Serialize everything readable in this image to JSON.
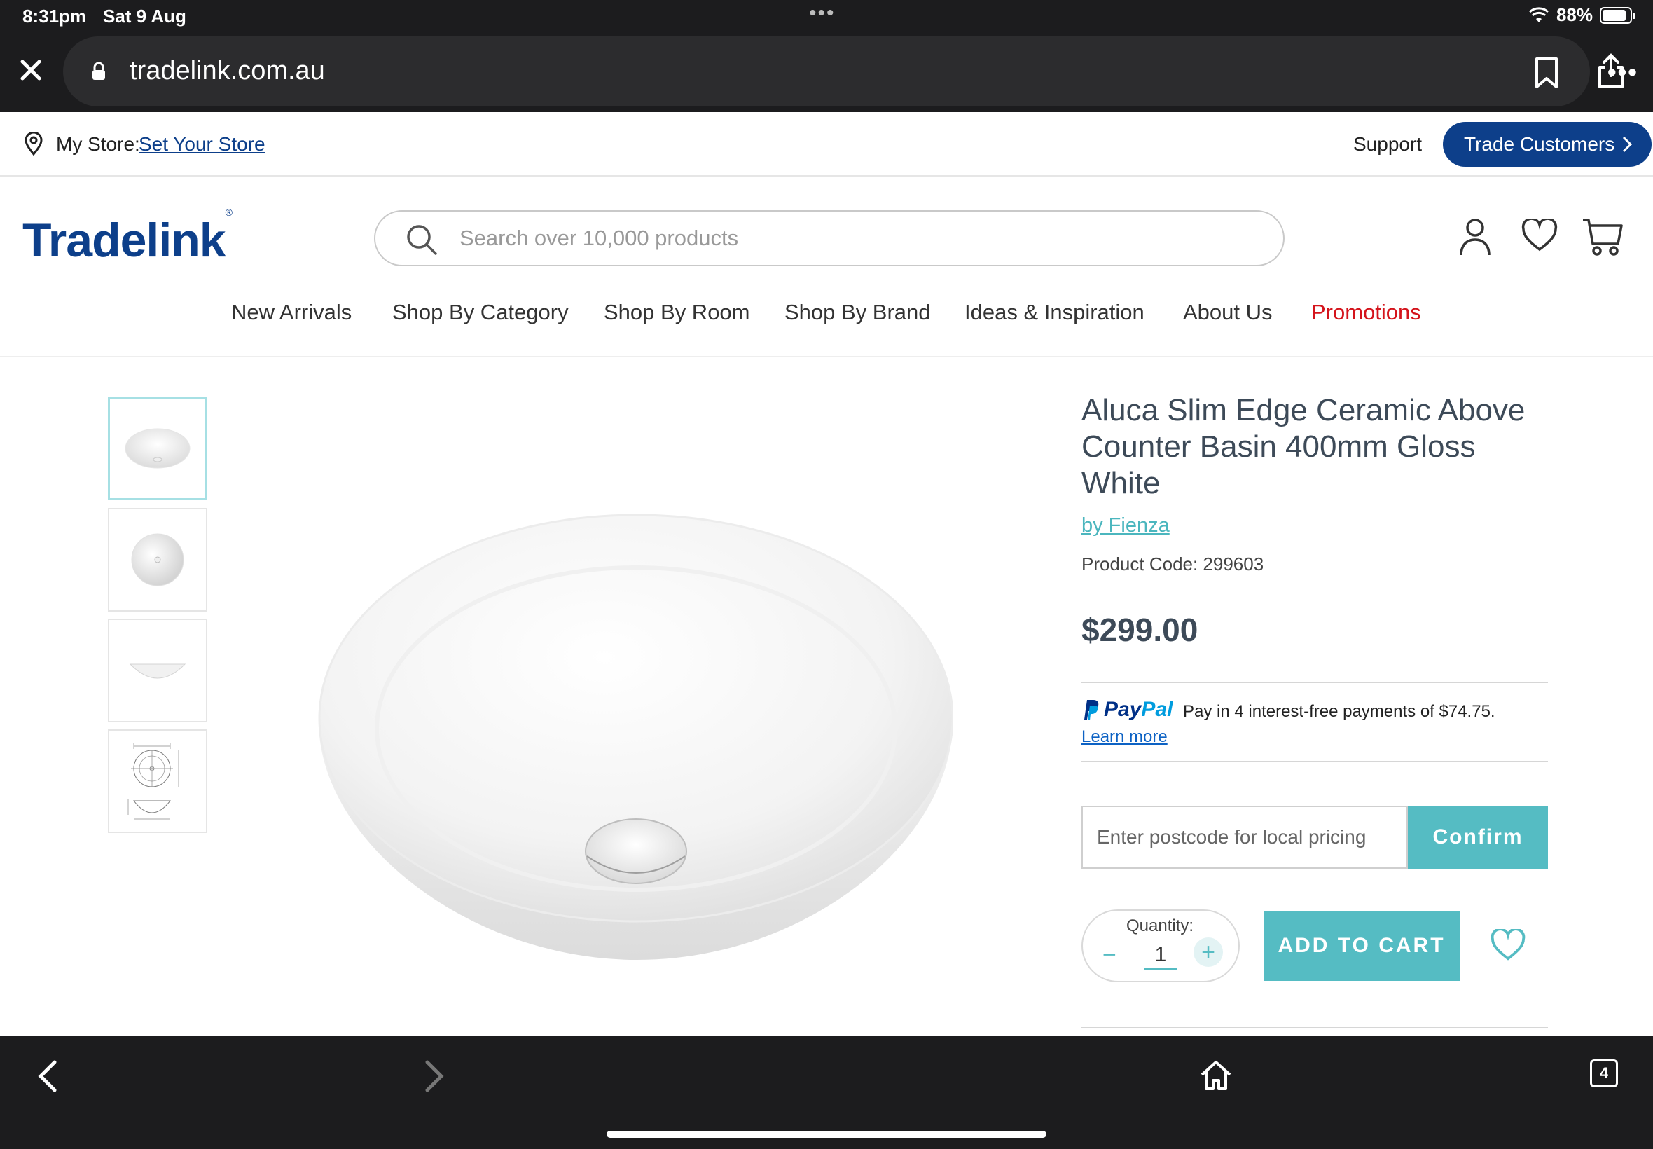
{
  "status_bar": {
    "time": "8:31pm",
    "date": "Sat 9 Aug",
    "battery": "88%",
    "battery_level": 0.88
  },
  "browser": {
    "url": "tradelink.com.au",
    "open_tabs": "4"
  },
  "utility_bar": {
    "store_label": "My Store:",
    "store_link": "Set Your Store",
    "support": "Support",
    "trade_customers": "Trade Customers"
  },
  "header": {
    "logo": "Tradelink",
    "logo_mark": "®",
    "search_placeholder": "Search over 10,000 products"
  },
  "nav": {
    "items": [
      "New Arrivals",
      "Shop By Category",
      "Shop By Room",
      "Shop By Brand",
      "Ideas & Inspiration",
      "About Us",
      "Promotions"
    ]
  },
  "product": {
    "title": "Aluca Slim Edge Ceramic Above Counter Basin 400mm Gloss White",
    "brand": "by Fienza",
    "code": "Product Code: 299603",
    "price": "$299.00",
    "paypal": {
      "brand_a": "Pay",
      "brand_b": "Pal",
      "text": "Pay in 4 interest-free payments of $74.75.",
      "learn_more": "Learn more"
    },
    "postcode_placeholder": "Enter postcode for local pricing",
    "confirm": "Confirm",
    "quantity_label": "Quantity:",
    "quantity_value": "1",
    "add_to_cart": "ADD TO CART"
  },
  "colors": {
    "brand_navy": "#0d3f8a",
    "accent_teal": "#55bcc3",
    "promo_red": "#d4141c",
    "text_slate": "#3d4a58"
  }
}
